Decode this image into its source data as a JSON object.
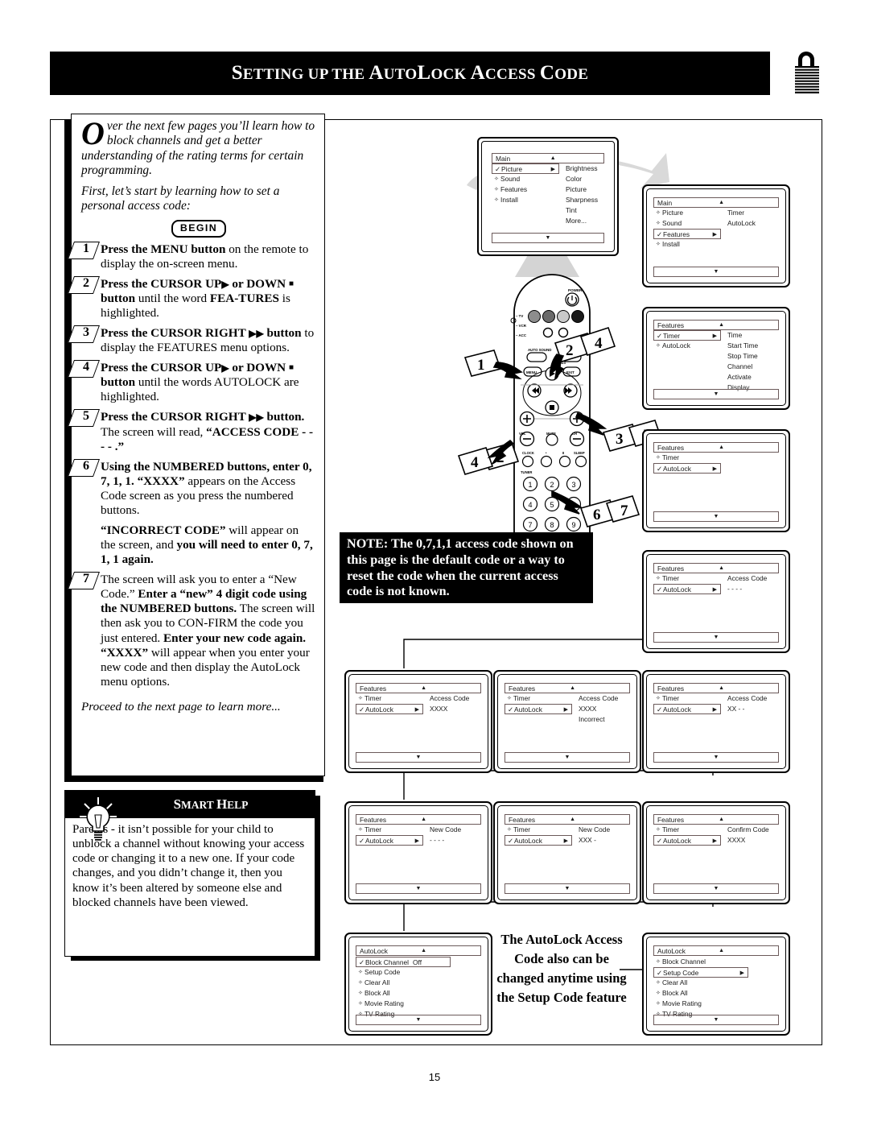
{
  "header": {
    "title_parts": [
      "S",
      "ETTING UP THE ",
      "A",
      "UTO",
      "L",
      "OCK ",
      "A",
      "CCESS ",
      "C",
      "ODE"
    ],
    "title": "SETTING UP THE AUTOLOCK ACCESS CODE",
    "lock_icon": "padlock-icon"
  },
  "intro": {
    "dropcap": "O",
    "p1": "ver the next few pages you’ll learn how to block channels and get a better understanding of the rating terms for certain programming.",
    "p2": "First, let’s start by learning how to set a personal access code:",
    "begin_label": "BEGIN"
  },
  "steps": [
    {
      "n": "1",
      "html": "<b>Press the MENU button</b> on the remote to display the on-screen menu."
    },
    {
      "n": "2",
      "html": "<b>Press the CURSOR UP<span class=\"tri\">▶</span> or DOWN <span class=\"sq\">■</span> button</b> until the word <b>FEA-TURES</b> is highlighted."
    },
    {
      "n": "3",
      "html": "<b>Press the CURSOR RIGHT <span class=\"tri\">▶▶</span> button</b> to display the FEATURES menu options."
    },
    {
      "n": "4",
      "html": "<b>Press the CURSOR UP<span class=\"tri\">▶</span> or DOWN <span class=\"sq\">■</span> button</b> until the words AUTOLOCK are highlighted."
    },
    {
      "n": "5",
      "html": "<b>Press the CURSOR RIGHT <span class=\"tri\">▶▶</span> button.</b> The screen will read, <b>“ACCESS CODE - - - - .”</b>"
    },
    {
      "n": "6",
      "html": "<b>Using the NUMBERED buttons, enter 0, 7, 1, 1. “XXXX”</b> appears on the Access Code screen as you press the numbered buttons."
    },
    {
      "n": "",
      "html": "<b>“INCORRECT CODE”</b> will appear on the screen, and <b>you will need to enter 0, 7, 1, 1 again.</b>"
    },
    {
      "n": "7",
      "html": "The screen will ask you to enter a “New Code.” <b>Enter a “new” 4 digit code using the NUMBERED buttons.</b> The screen will then ask you to CON-FIRM the code you just entered. <b>Enter your new code again. “XXXX”</b> will appear when you enter your new code and then display the AutoLock menu options."
    }
  ],
  "proceed": "Proceed to the next page to learn more...",
  "smart_help": {
    "title_parts": [
      "S",
      "MART ",
      "H",
      "ELP"
    ],
    "title": "SMART HELP",
    "icon": "lightbulb-icon",
    "body": "Parents - it isn’t possible for your child to unblock a channel without knowing your access code or changing it to a new one. If your code changes, and you didn’t change it, then you know it’s been altered by someone else and blocked channels have been viewed."
  },
  "note": "NOTE: The 0,7,1,1 access code shown on this page is the default code or a way to reset the code when the current access code is not known.",
  "remote": {
    "labels": [
      "POWER",
      "TV",
      "VCR",
      "ACC",
      "AUTO SOUND",
      "PICTURE",
      "MENU",
      "STATUS",
      "EXIT",
      "MUTE",
      "CH",
      "VOL",
      "CLOCK",
      "SLEEP",
      "TUNER"
    ],
    "callouts": [
      "1",
      "2",
      "4",
      "3",
      "5",
      "2",
      "4",
      "6",
      "7"
    ],
    "keypad": [
      "1",
      "2",
      "3",
      "4",
      "5",
      "6",
      "7",
      "8",
      "9"
    ]
  },
  "screens": {
    "tv_main": {
      "title": "Main",
      "up": "▲",
      "down": "▼",
      "left": [
        {
          "mark": "✓",
          "label": "Picture",
          "arrow": "▶",
          "sel": true
        },
        {
          "mark": "✧",
          "label": "Sound"
        },
        {
          "mark": "✧",
          "label": "Features"
        },
        {
          "mark": "✧",
          "label": "Install"
        }
      ],
      "right": [
        "Brightness",
        "Color",
        "Picture",
        "Sharpness",
        "Tint",
        "More..."
      ]
    },
    "s1": {
      "title": "Main",
      "left": [
        {
          "mark": "✧",
          "label": "Picture"
        },
        {
          "mark": "✧",
          "label": "Sound"
        },
        {
          "mark": "✓",
          "label": "Features",
          "arrow": "▶",
          "sel": true
        },
        {
          "mark": "✧",
          "label": "Install"
        }
      ],
      "right": [
        "Timer",
        "AutoLock"
      ]
    },
    "s2": {
      "title": "Features",
      "left": [
        {
          "mark": "✓",
          "label": "Timer",
          "arrow": "▶",
          "sel": true
        },
        {
          "mark": "✧",
          "label": "AutoLock"
        }
      ],
      "right": [
        "Time",
        "Start Time",
        "Stop Time",
        "Channel",
        "Activate",
        "Display"
      ]
    },
    "s3": {
      "title": "Features",
      "left": [
        {
          "mark": "✧",
          "label": "Timer"
        },
        {
          "mark": "✓",
          "label": "AutoLock",
          "arrow": "▶",
          "sel": true
        }
      ],
      "right": []
    },
    "s4": {
      "title": "Features",
      "left": [
        {
          "mark": "✧",
          "label": "Timer"
        },
        {
          "mark": "✓",
          "label": "AutoLock",
          "arrow": "▶",
          "sel": true
        }
      ],
      "right": [
        "Access Code",
        "- - - -"
      ]
    },
    "s5": {
      "title": "Features",
      "left": [
        {
          "mark": "✧",
          "label": "Timer"
        },
        {
          "mark": "✓",
          "label": "AutoLock",
          "arrow": "▶",
          "sel": true
        }
      ],
      "right": [
        "Access Code",
        "XXXX"
      ]
    },
    "s6": {
      "title": "Features",
      "left": [
        {
          "mark": "✧",
          "label": "Timer"
        },
        {
          "mark": "✓",
          "label": "AutoLock",
          "arrow": "▶",
          "sel": true
        }
      ],
      "right": [
        "Access Code",
        "XXXX"
      ],
      "extra": "Incorrect"
    },
    "s7": {
      "title": "Features",
      "left": [
        {
          "mark": "✧",
          "label": "Timer"
        },
        {
          "mark": "✓",
          "label": "AutoLock",
          "arrow": "▶",
          "sel": true
        }
      ],
      "right": [
        "Access Code",
        "XX - -"
      ]
    },
    "s8": {
      "title": "Features",
      "left": [
        {
          "mark": "✧",
          "label": "Timer"
        },
        {
          "mark": "✓",
          "label": "AutoLock",
          "arrow": "▶",
          "sel": true
        }
      ],
      "right": [
        "New Code",
        "- - - -"
      ]
    },
    "s9": {
      "title": "Features",
      "left": [
        {
          "mark": "✧",
          "label": "Timer"
        },
        {
          "mark": "✓",
          "label": "AutoLock",
          "arrow": "▶",
          "sel": true
        }
      ],
      "right": [
        "New Code",
        "XXX -"
      ]
    },
    "s10": {
      "title": "Features",
      "left": [
        {
          "mark": "✧",
          "label": "Timer"
        },
        {
          "mark": "✓",
          "label": "AutoLock",
          "arrow": "▶",
          "sel": true
        }
      ],
      "right": [
        "Confirm Code",
        "XXXX"
      ]
    },
    "s11": {
      "title": "AutoLock",
      "items": [
        {
          "mark": "✓",
          "label": "Block Channel",
          "value": "Off",
          "sel": true
        },
        {
          "mark": "✧",
          "label": "Setup Code"
        },
        {
          "mark": "✧",
          "label": "Clear All"
        },
        {
          "mark": "✧",
          "label": "Block All"
        },
        {
          "mark": "✧",
          "label": "Movie Rating"
        },
        {
          "mark": "✧",
          "label": "TV Rating"
        }
      ]
    },
    "s12": {
      "title": "AutoLock",
      "items": [
        {
          "mark": "✧",
          "label": "Block Channel"
        },
        {
          "mark": "✓",
          "label": "Setup Code",
          "arrow": "▶",
          "sel": true
        },
        {
          "mark": "✧",
          "label": "Clear All"
        },
        {
          "mark": "✧",
          "label": "Block All"
        },
        {
          "mark": "✧",
          "label": "Movie Rating"
        },
        {
          "mark": "✧",
          "label": "TV Rating"
        }
      ]
    }
  },
  "caption": "The AutoLock Access Code also can be changed anytime using the Setup Code feature",
  "page_number": "15"
}
